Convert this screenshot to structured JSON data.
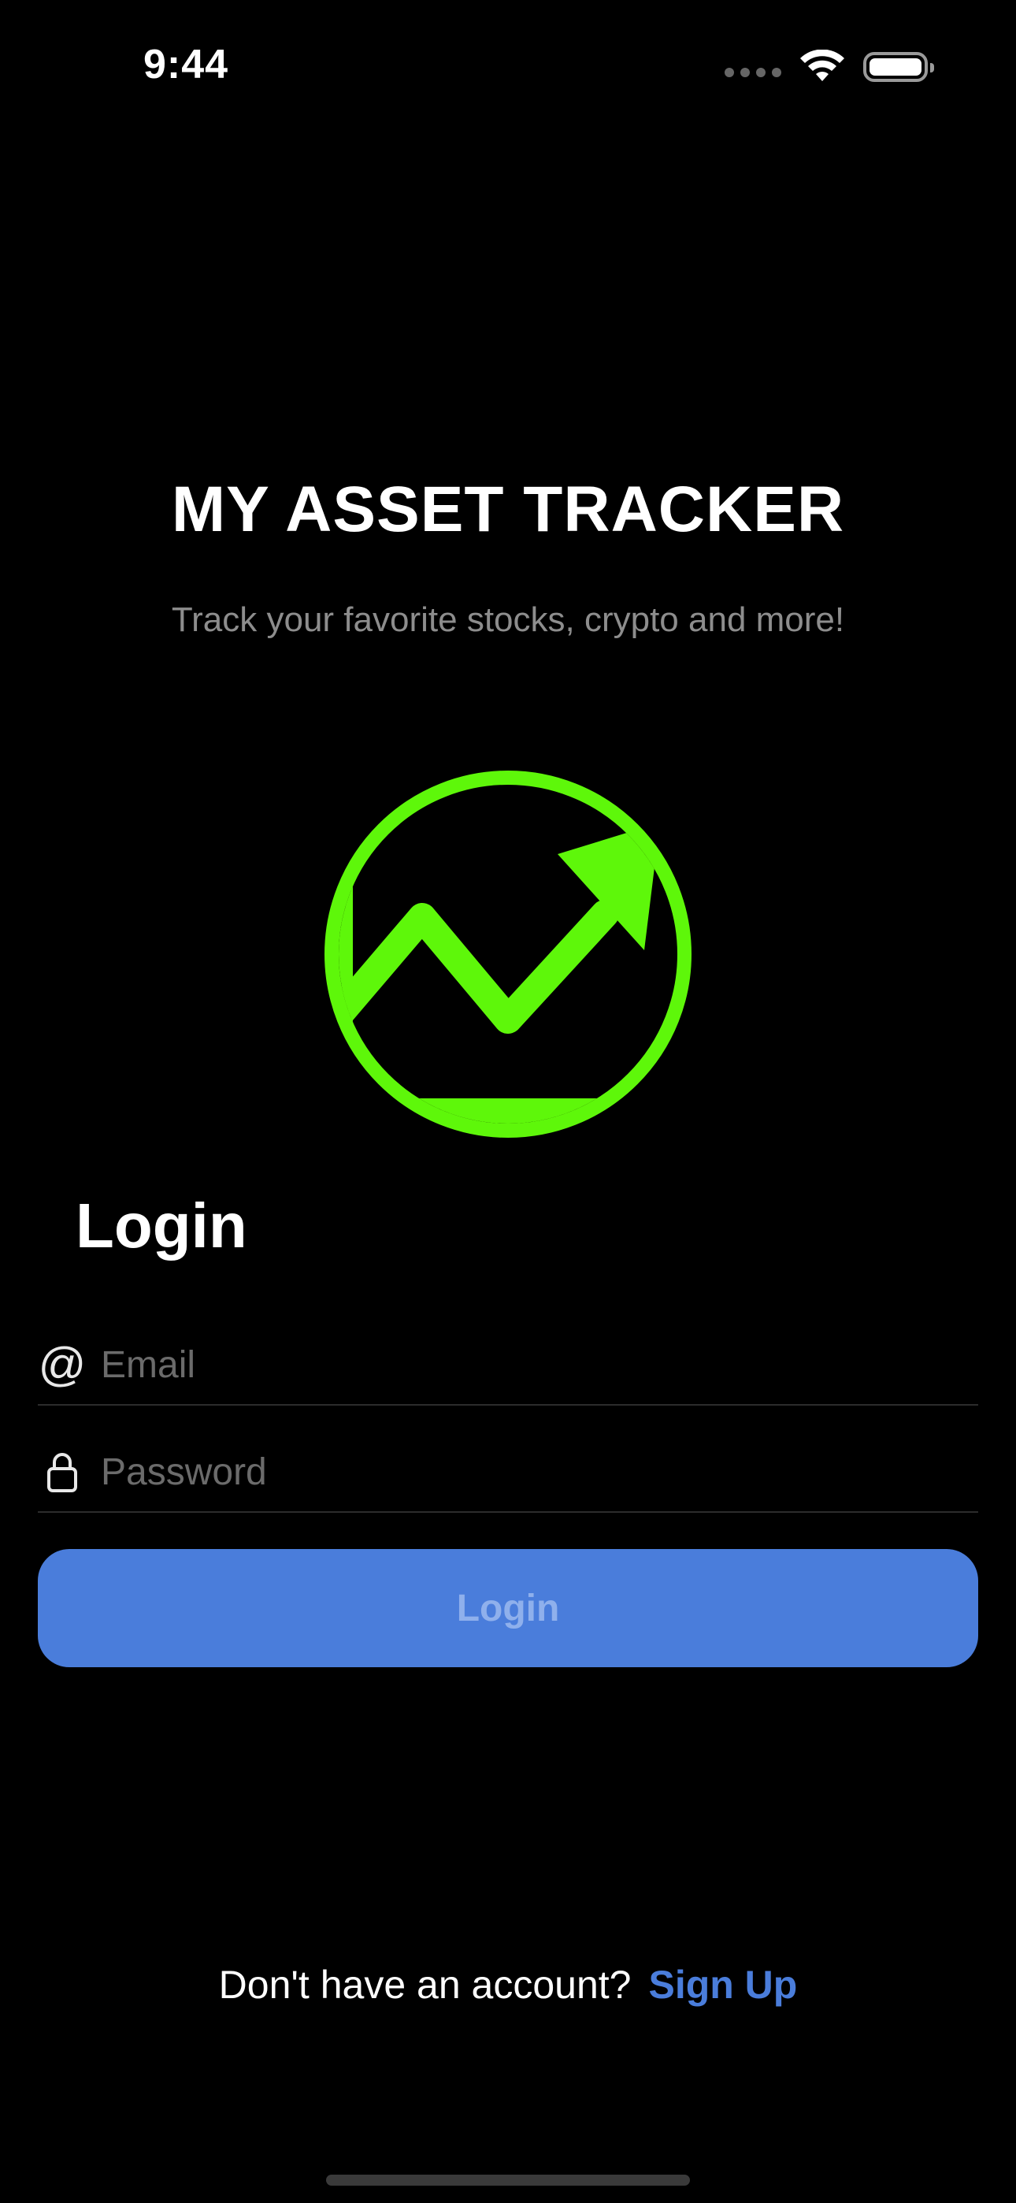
{
  "status_bar": {
    "time": "9:44"
  },
  "header": {
    "title": "MY ASSET TRACKER",
    "subtitle": "Track your favorite stocks, crypto and more!"
  },
  "logo": {
    "icon": "trending-up-chart-icon",
    "color": "#5ef70a"
  },
  "login": {
    "heading": "Login",
    "email": {
      "placeholder": "Email",
      "value": "",
      "icon": "at-icon"
    },
    "password": {
      "placeholder": "Password",
      "value": "",
      "icon": "lock-icon"
    },
    "button_label": "Login",
    "button_color": "#4a7ddb"
  },
  "signup": {
    "prompt": "Don't have an account?",
    "link_label": "Sign Up",
    "link_color": "#4a7ddb"
  }
}
